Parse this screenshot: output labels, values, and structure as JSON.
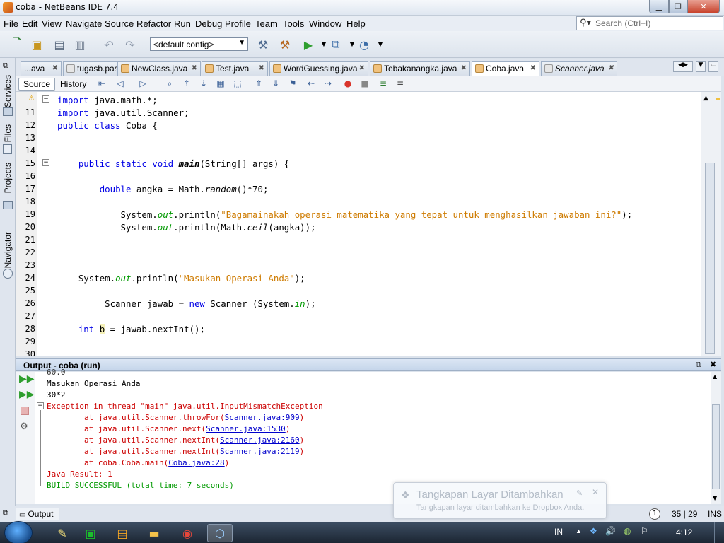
{
  "window": {
    "title": "coba - NetBeans IDE 7.4"
  },
  "menu": [
    "File",
    "Edit",
    "View",
    "Navigate",
    "Source",
    "Refactor",
    "Run",
    "Debug",
    "Profile",
    "Team",
    "Tools",
    "Window",
    "Help"
  ],
  "search": {
    "placeholder": "Search (Ctrl+I)"
  },
  "toolbar": {
    "config_value": "<default config>"
  },
  "sidebar": [
    "Services",
    "Files",
    "Projects",
    "Navigator"
  ],
  "tabs": [
    {
      "label": "...ava"
    },
    {
      "label": "tugasb.pas"
    },
    {
      "label": "NewClass.java"
    },
    {
      "label": "Test.java"
    },
    {
      "label": "WordGuessing.java"
    },
    {
      "label": "Tebakanangka.java"
    },
    {
      "label": "Coba.java"
    },
    {
      "label": "Scanner.java"
    }
  ],
  "editor_toolbar": {
    "source_label": "Source",
    "history_label": "History"
  },
  "editor": {
    "line_numbers": [
      "",
      "11",
      "12",
      "13",
      "14",
      "15",
      "16",
      "17",
      "18",
      "19",
      "20",
      "21",
      "22",
      "23",
      "24",
      "25",
      "26",
      "27",
      "28",
      "29",
      "30"
    ]
  },
  "output": {
    "title": "Output - coba (run)",
    "lines": [
      "60.0",
      "Masukan Operasi Anda",
      "30*2",
      "Exception in thread \"main\" java.util.InputMismatchException",
      "        at java.util.Scanner.throwFor(",
      "Scanner.java:909",
      "        at java.util.Scanner.next(",
      "Scanner.java:1530",
      "        at java.util.Scanner.nextInt(",
      "Scanner.java:2160",
      "        at java.util.Scanner.nextInt(",
      "Scanner.java:2119",
      "        at coba.Coba.main(",
      "Coba.java:28",
      "Java Result: 1",
      "BUILD SUCCESSFUL (total time: 7 seconds)"
    ]
  },
  "status": {
    "output_tab": "Output",
    "badge": "1",
    "position": "35 | 29",
    "mode": "INS"
  },
  "notification": {
    "title": "Tangkapan Layar Ditambahkan",
    "body": "Tangkapan layar ditambahkan ke Dropbox Anda."
  },
  "taskbar": {
    "lang": "IN",
    "clock": "4:12"
  },
  "colors": {
    "keyword": "#0000e6",
    "string": "#ce7b00",
    "error": "#cc0000",
    "success": "#009900"
  }
}
